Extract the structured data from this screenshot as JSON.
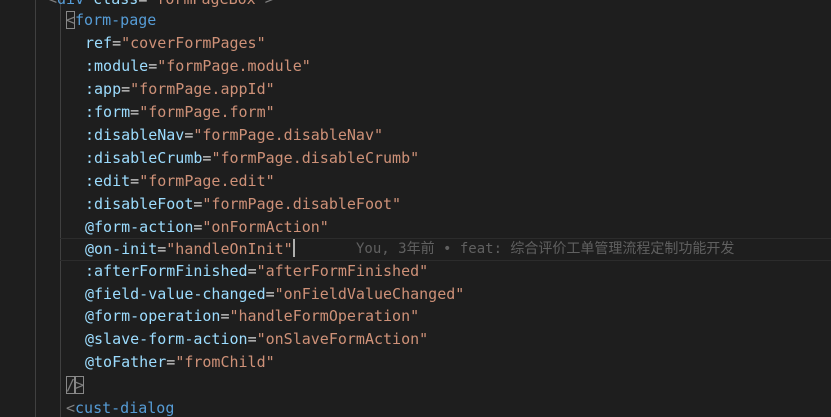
{
  "editor": {
    "lines": [
      {
        "open": "<",
        "tag": "div",
        "attr": " class",
        "eq": "=",
        "str": "\"formPageBox\"",
        "close": ">"
      },
      {
        "open": "<",
        "tag": "form-page"
      },
      {
        "attr": "ref",
        "eq": "=",
        "str": "\"coverFormPages\""
      },
      {
        "attr": ":module",
        "eq": "=",
        "str": "\"formPage.module\""
      },
      {
        "attr": ":app",
        "eq": "=",
        "str": "\"formPage.appId\""
      },
      {
        "attr": ":form",
        "eq": "=",
        "str": "\"formPage.form\""
      },
      {
        "attr": ":disableNav",
        "eq": "=",
        "str": "\"formPage.disableNav\""
      },
      {
        "attr": ":disableCrumb",
        "eq": "=",
        "str": "\"formPage.disableCrumb\""
      },
      {
        "attr": ":edit",
        "eq": "=",
        "str": "\"formPage.edit\""
      },
      {
        "attr": ":disableFoot",
        "eq": "=",
        "str": "\"formPage.disableFoot\""
      },
      {
        "attr": "@form-action",
        "eq": "=",
        "str": "\"onFormAction\""
      },
      {
        "attr": "@on-init",
        "eq": "=",
        "str": "\"handleOnInit\""
      },
      {
        "attr": ":afterFormFinished",
        "eq": "=",
        "str": "\"afterFormFinished\""
      },
      {
        "attr": "@field-value-changed",
        "eq": "=",
        "str": "\"onFieldValueChanged\""
      },
      {
        "attr": "@form-operation",
        "eq": "=",
        "str": "\"handleFormOperation\""
      },
      {
        "attr": "@slave-form-action",
        "eq": "=",
        "str": "\"onSlaveFormAction\""
      },
      {
        "attr": "@toFather",
        "eq": "=",
        "str": "\"fromChild\""
      },
      {
        "open": "/",
        "close": ">"
      },
      {
        "open": "<",
        "tag": "cust-dialog"
      }
    ],
    "blame": "You, 3年前 • feat: 综合评价工单管理流程定制功能开发"
  }
}
